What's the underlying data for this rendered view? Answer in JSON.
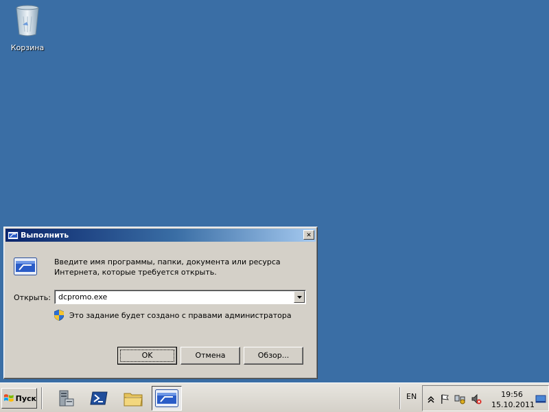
{
  "desktop": {
    "recycle_bin_label": "Корзина"
  },
  "run_dialog": {
    "title": "Выполнить",
    "prompt_line1": "Введите имя программы, папки, документа или ресурса",
    "prompt_line2": "Интернета, которые требуется открыть.",
    "open_label": "Открыть:",
    "open_value": "dcpromo.exe",
    "uac_note": "Это задание будет создано с правами администратора",
    "ok_label": "OK",
    "cancel_label": "Отмена",
    "browse_label": "Обзор...",
    "close_glyph": "✕"
  },
  "taskbar": {
    "start_label": "Пуск",
    "apps": [
      {
        "icon": "server-manager-icon"
      },
      {
        "icon": "powershell-icon"
      },
      {
        "icon": "explorer-folder-icon"
      },
      {
        "icon": "run-dialog-icon",
        "active": true
      }
    ],
    "language": "EN",
    "tray_icons": [
      "show-hidden-icons-chevron",
      "action-center-flag-icon",
      "network-icon",
      "volume-muted-icon",
      "show-desktop-icon"
    ],
    "time": "19:56",
    "date": "15.10.2011"
  },
  "colors": {
    "desktop_bg": "#3a6ea5",
    "title_gradient_start": "#0a246a",
    "title_gradient_end": "#a6caf0",
    "dialog_face": "#d4d0c8"
  }
}
